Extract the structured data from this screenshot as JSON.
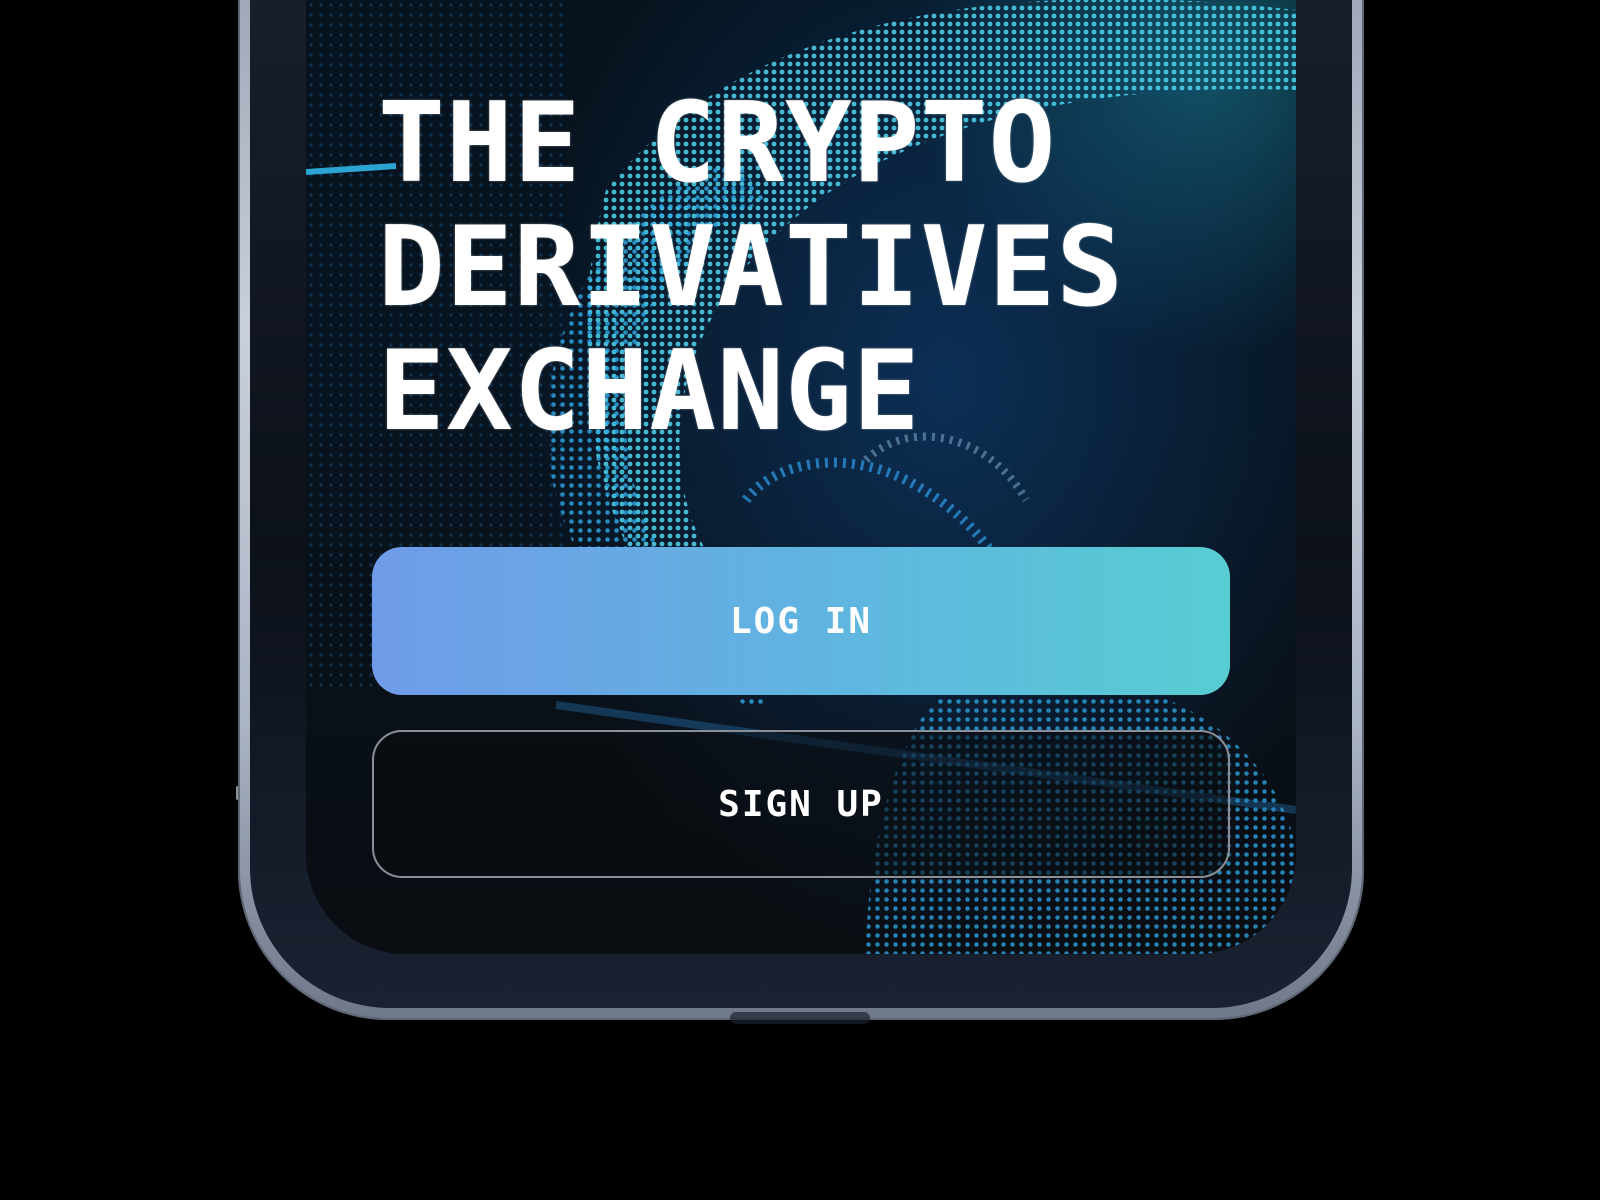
{
  "hero": {
    "headline_lines": [
      "THE CRYPTO",
      "DERIVATIVES",
      "EXCHANGE"
    ]
  },
  "actions": {
    "login_label": "LOG IN",
    "signup_label": "SIGN UP"
  },
  "colors": {
    "login_gradient_start": "#6f9be8",
    "login_gradient_end": "#57cdd2",
    "signup_border": "#8a8f98",
    "screen_background": "#0b0e12",
    "globe_dots": "#2fa8e6"
  }
}
